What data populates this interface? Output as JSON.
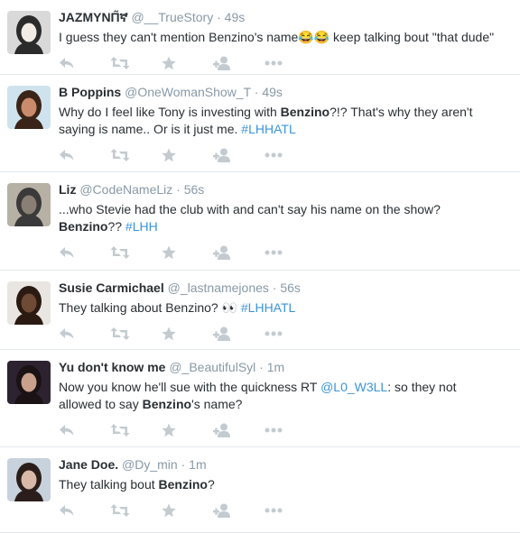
{
  "actions": {
    "reply_icon": "reply-icon",
    "retweet_icon": "retweet-icon",
    "favorite_icon": "star-icon",
    "follow_icon": "follow-icon",
    "more_icon": "more-icon"
  },
  "colors": {
    "link": "#3b94d9",
    "muted": "#8899a6",
    "icon": "#c3cbd0",
    "text": "#292f33"
  },
  "tweets": [
    {
      "name": "JAZMYNΠ̃ኛ",
      "handle": "@__TrueStory",
      "time": "49s",
      "segments": [
        {
          "t": "I guess they can't mention Benzino's name😂😂 keep talking bout \"that dude\""
        }
      ]
    },
    {
      "name": "B Poppins",
      "handle": "@OneWomanShow_T",
      "time": "49s",
      "segments": [
        {
          "t": "Why do I feel like Tony is investing with "
        },
        {
          "t": "Benzino",
          "s": "b"
        },
        {
          "t": "?!? That's why they aren't saying is name.. Or is it just me. "
        },
        {
          "t": "#LHHATL",
          "s": "link"
        }
      ]
    },
    {
      "name": "Liz",
      "handle": "@CodeNameLiz",
      "time": "56s",
      "segments": [
        {
          "t": "...who Stevie had the club with and can't say his name on the show? "
        },
        {
          "t": "Benzino",
          "s": "b"
        },
        {
          "t": "?? "
        },
        {
          "t": "#LHH",
          "s": "link"
        }
      ]
    },
    {
      "name": "Susie Carmichael",
      "handle": "@_lastnamejones",
      "time": "56s",
      "segments": [
        {
          "t": "They talking about Benzino? 👀 "
        },
        {
          "t": "#LHHATL",
          "s": "link"
        }
      ]
    },
    {
      "name": "Yu don't know me",
      "handle": "@_BeautifulSyl",
      "time": "1m",
      "segments": [
        {
          "t": "Now you know he'll sue with the quickness RT "
        },
        {
          "t": "@L0_W3LL",
          "s": "link"
        },
        {
          "t": ": so they not allowed to say "
        },
        {
          "t": "Benzino",
          "s": "b"
        },
        {
          "t": "'s name?"
        }
      ]
    },
    {
      "name": "Jane Doe.",
      "handle": "@Dy_min",
      "time": "1m",
      "segments": [
        {
          "t": "They talking bout "
        },
        {
          "t": "Benzino",
          "s": "b"
        },
        {
          "t": "?"
        }
      ]
    }
  ]
}
